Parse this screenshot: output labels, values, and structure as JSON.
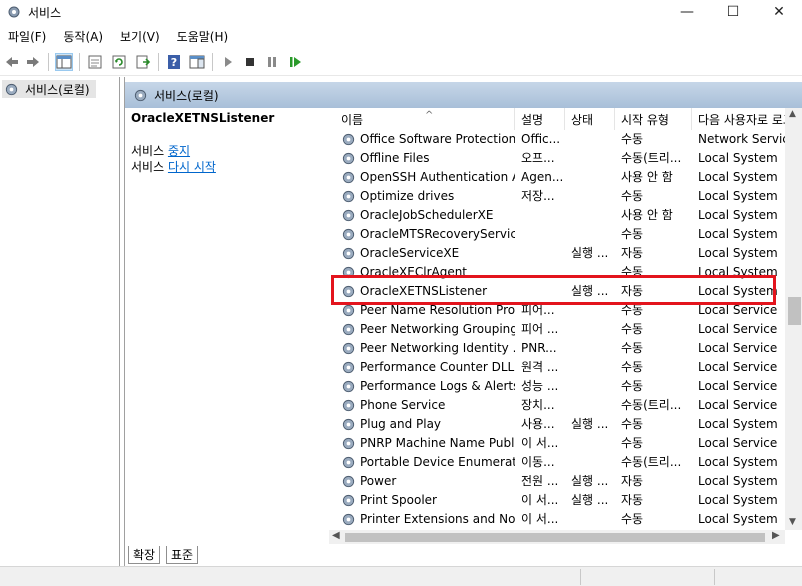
{
  "window": {
    "title": "서비스",
    "minimize": "—",
    "maximize": "☐",
    "close": "✕"
  },
  "menu": [
    "파일(F)",
    "동작(A)",
    "보기(V)",
    "도움말(H)"
  ],
  "toolbar": {
    "buttons": [
      "back-arrow-icon",
      "forward-arrow-icon",
      "show-hide-console-tree-icon",
      "properties-icon",
      "refresh-icon",
      "export-list-icon",
      "help-icon",
      "action-pane-icon",
      "start-service-icon",
      "stop-service-icon",
      "pause-service-icon",
      "restart-service-icon"
    ]
  },
  "tree": {
    "item": "서비스(로컬)"
  },
  "panel": {
    "header": "서비스(로컬)"
  },
  "description": {
    "service_name": "OracleXETNSListener",
    "line1_prefix": "서비스 ",
    "line1_link": "중지",
    "line2_prefix": "서비스 ",
    "line2_link": "다시 시작"
  },
  "columns": [
    "이름",
    "설명",
    "상태",
    "시작 유형",
    "다음 사용자로 로그온"
  ],
  "rows": [
    {
      "name": "Office Software Protection ...",
      "desc": "Offic...",
      "status": "",
      "startup": "수동",
      "logon": "Network Service"
    },
    {
      "name": "Offline Files",
      "desc": "오프...",
      "status": "",
      "startup": "수동(트리...",
      "logon": "Local System"
    },
    {
      "name": "OpenSSH Authentication A...",
      "desc": "Agen...",
      "status": "",
      "startup": "사용 안 함",
      "logon": "Local System"
    },
    {
      "name": "Optimize drives",
      "desc": "저장...",
      "status": "",
      "startup": "수동",
      "logon": "Local System"
    },
    {
      "name": "OracleJobSchedulerXE",
      "desc": "",
      "status": "",
      "startup": "사용 안 함",
      "logon": "Local System"
    },
    {
      "name": "OracleMTSRecoveryService",
      "desc": "",
      "status": "",
      "startup": "수동",
      "logon": "Local System"
    },
    {
      "name": "OracleServiceXE",
      "desc": "",
      "status": "실행 ...",
      "startup": "자동",
      "logon": "Local System"
    },
    {
      "name": "OracleXEClrAgent",
      "desc": "",
      "status": "",
      "startup": "수동",
      "logon": "Local System"
    },
    {
      "name": "OracleXETNSListener",
      "desc": "",
      "status": "실행 ...",
      "startup": "자동",
      "logon": "Local System"
    },
    {
      "name": "Peer Name Resolution Prot...",
      "desc": "피어...",
      "status": "",
      "startup": "수동",
      "logon": "Local Service"
    },
    {
      "name": "Peer Networking Grouping",
      "desc": "피어 ...",
      "status": "",
      "startup": "수동",
      "logon": "Local Service"
    },
    {
      "name": "Peer Networking Identity ...",
      "desc": "PNR...",
      "status": "",
      "startup": "수동",
      "logon": "Local Service"
    },
    {
      "name": "Performance Counter DLL ...",
      "desc": "원격 ...",
      "status": "",
      "startup": "수동",
      "logon": "Local Service"
    },
    {
      "name": "Performance Logs & Alerts",
      "desc": "성능 ...",
      "status": "",
      "startup": "수동",
      "logon": "Local Service"
    },
    {
      "name": "Phone Service",
      "desc": "장치...",
      "status": "",
      "startup": "수동(트리...",
      "logon": "Local Service"
    },
    {
      "name": "Plug and Play",
      "desc": "사용...",
      "status": "실행 ...",
      "startup": "수동",
      "logon": "Local System"
    },
    {
      "name": "PNRP Machine Name Publi...",
      "desc": "이 서...",
      "status": "",
      "startup": "수동",
      "logon": "Local Service"
    },
    {
      "name": "Portable Device Enumerato...",
      "desc": "이동...",
      "status": "",
      "startup": "수동(트리...",
      "logon": "Local System"
    },
    {
      "name": "Power",
      "desc": "전원 ...",
      "status": "실행 ...",
      "startup": "자동",
      "logon": "Local System"
    },
    {
      "name": "Print Spooler",
      "desc": "이 서...",
      "status": "실행 ...",
      "startup": "자동",
      "logon": "Local System"
    },
    {
      "name": "Printer Extensions and Noti...",
      "desc": "이 서...",
      "status": "",
      "startup": "수동",
      "logon": "Local System"
    }
  ],
  "selected_row": 8,
  "tabs": [
    "확장",
    "표준"
  ],
  "colors": {
    "highlight": "#e3141d",
    "header_bg": "#b4c8de",
    "link": "#0066cc"
  }
}
